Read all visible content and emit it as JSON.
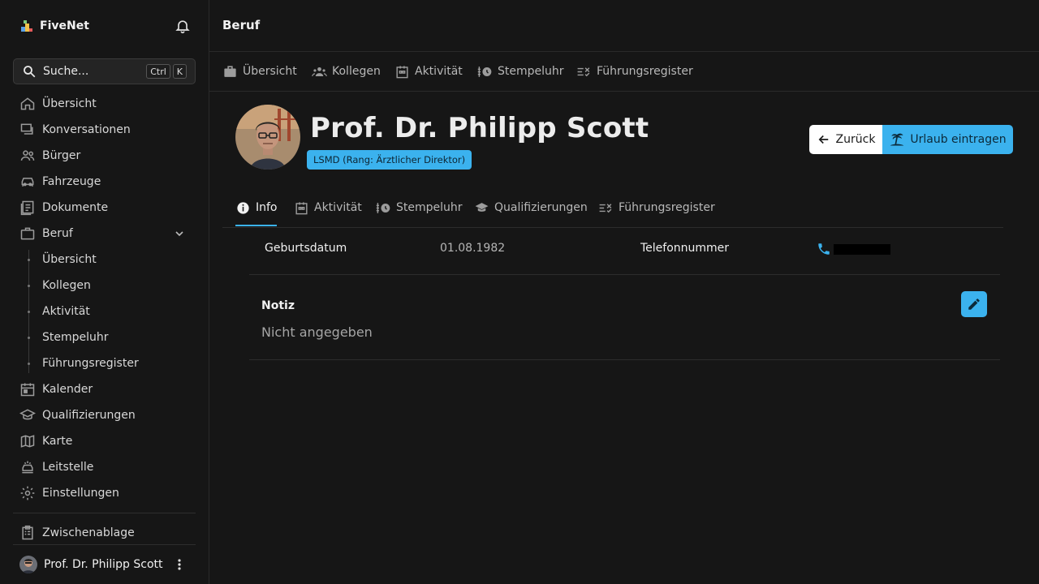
{
  "app": {
    "name": "FiveNet"
  },
  "search": {
    "placeholder": "Suche...",
    "key_ctrl": "Ctrl",
    "key_k": "K"
  },
  "sidebar": {
    "items": [
      {
        "label": "Übersicht",
        "icon": "home-icon"
      },
      {
        "label": "Konversationen",
        "icon": "chat-icon"
      },
      {
        "label": "Bürger",
        "icon": "users-icon"
      },
      {
        "label": "Fahrzeuge",
        "icon": "car-icon"
      },
      {
        "label": "Dokumente",
        "icon": "document-icon"
      },
      {
        "label": "Beruf",
        "icon": "briefcase-icon"
      },
      {
        "label": "Kalender",
        "icon": "calendar-icon"
      },
      {
        "label": "Qualifizierungen",
        "icon": "school-icon"
      },
      {
        "label": "Karte",
        "icon": "map-icon"
      },
      {
        "label": "Leitstelle",
        "icon": "dispatch-icon"
      },
      {
        "label": "Einstellungen",
        "icon": "gear-icon"
      }
    ],
    "job_sub": [
      "Übersicht",
      "Kollegen",
      "Aktivität",
      "Stempeluhr",
      "Führungsregister"
    ],
    "clipboard": "Zwischenablage",
    "user": "Prof. Dr. Philipp Scott"
  },
  "header": {
    "title": "Beruf"
  },
  "subnav": [
    "Übersicht",
    "Kollegen",
    "Aktivität",
    "Stempeluhr",
    "Führungsregister"
  ],
  "profile": {
    "name": "Prof. Dr. Philipp Scott",
    "badge": "LSMD (Rang: Ärztlicher Direktor)",
    "back_label": "Zurück",
    "vacation_label": "Urlaub eintragen"
  },
  "tabs": [
    "Info",
    "Aktivität",
    "Stempeluhr",
    "Qualifizierungen",
    "Führungsregister"
  ],
  "info": {
    "birth_label": "Geburtsdatum",
    "birth_value": "01.08.1982",
    "phone_label": "Telefonnummer",
    "note_label": "Notiz",
    "note_value": "Nicht angegeben"
  },
  "colors": {
    "accent": "#3bb2ee",
    "background": "#161616"
  }
}
